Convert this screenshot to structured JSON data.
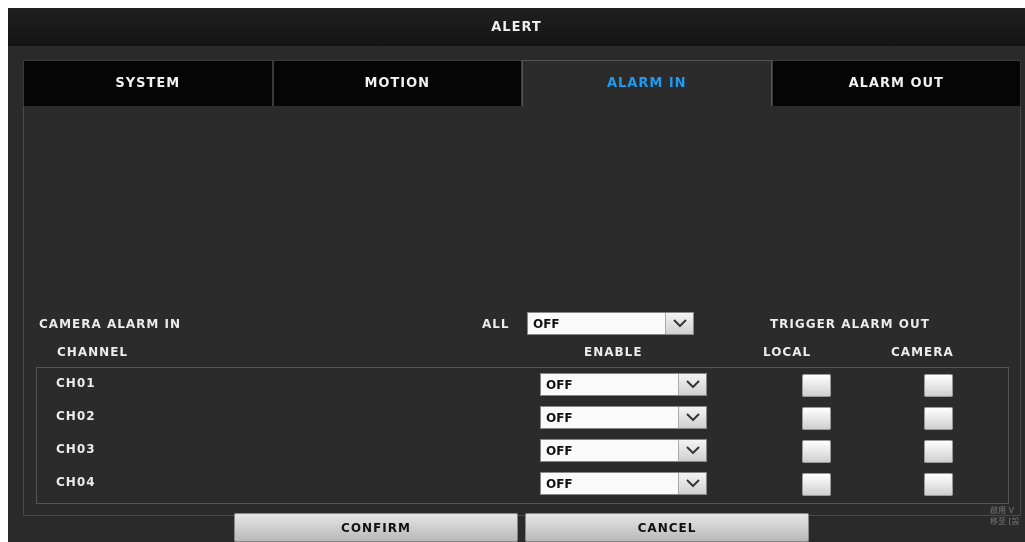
{
  "window": {
    "title": "ALERT"
  },
  "tabs": [
    {
      "label": "SYSTEM",
      "active": false
    },
    {
      "label": "MOTION",
      "active": false
    },
    {
      "label": "ALARM IN",
      "active": true
    },
    {
      "label": "ALARM OUT",
      "active": false
    }
  ],
  "alarm_in": {
    "section_label": "CAMERA ALARM IN",
    "all_label": "ALL",
    "all_value": "OFF",
    "trigger_label": "TRIGGER ALARM OUT",
    "columns": {
      "channel": "CHANNEL",
      "enable": "ENABLE",
      "local": "LOCAL",
      "camera": "CAMERA"
    },
    "channels": [
      {
        "name": "CH01",
        "enable": "OFF",
        "local": false,
        "camera": false
      },
      {
        "name": "CH02",
        "enable": "OFF",
        "local": false,
        "camera": false
      },
      {
        "name": "CH03",
        "enable": "OFF",
        "local": false,
        "camera": false
      },
      {
        "name": "CH04",
        "enable": "OFF",
        "local": false,
        "camera": false
      }
    ]
  },
  "buttons": {
    "confirm": "CONFIRM",
    "cancel": "CANCEL"
  },
  "watermark": {
    "line1": "啟用 V",
    "line2": "移至 [設"
  },
  "colors": {
    "active_tab": "#1e9bf0",
    "panel_bg": "#2b2b2b",
    "title_bg": "#1a1a1a"
  },
  "icons": {
    "dropdown": "chevron-down-icon"
  }
}
